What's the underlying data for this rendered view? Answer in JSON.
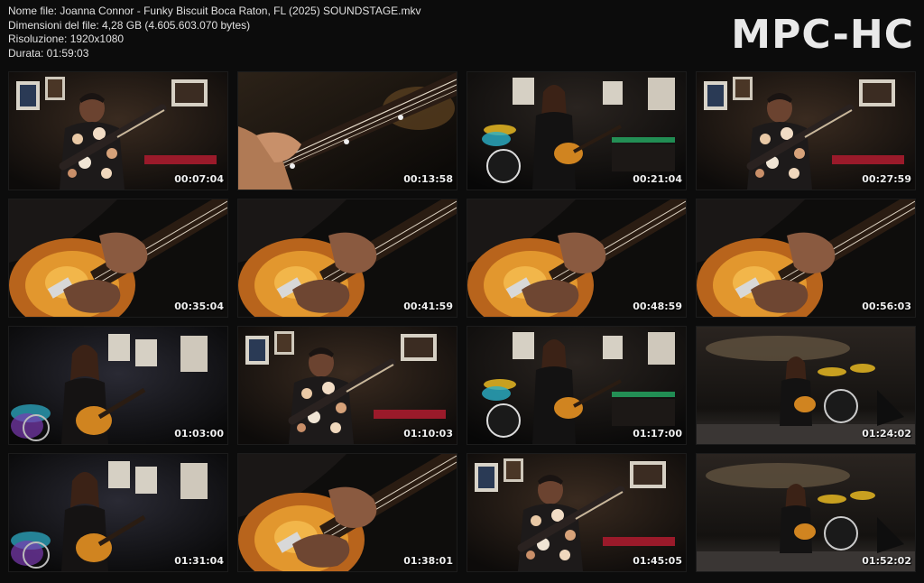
{
  "header": {
    "file_name": "Nome file: Joanna Connor - Funky Biscuit Boca Raton, FL (2025) SOUNDSTAGE.mkv",
    "file_size": "Dimensioni del file: 4,28 GB (4.605.603.070 bytes)",
    "resolution": "Risoluzione: 1920x1080",
    "duration": "Durata: 01:59:03",
    "logo": "MPC-HC"
  },
  "thumbnails": [
    {
      "time": "00:07:04",
      "scene": "bassist"
    },
    {
      "time": "00:13:58",
      "scene": "neck"
    },
    {
      "time": "00:21:04",
      "scene": "band"
    },
    {
      "time": "00:27:59",
      "scene": "bassist"
    },
    {
      "time": "00:35:04",
      "scene": "guitar"
    },
    {
      "time": "00:41:59",
      "scene": "guitar"
    },
    {
      "time": "00:48:59",
      "scene": "guitar"
    },
    {
      "time": "00:56:03",
      "scene": "guitar"
    },
    {
      "time": "01:03:00",
      "scene": "singer"
    },
    {
      "time": "01:10:03",
      "scene": "bassist"
    },
    {
      "time": "01:17:00",
      "scene": "band"
    },
    {
      "time": "01:24:02",
      "scene": "stage"
    },
    {
      "time": "01:31:04",
      "scene": "singer"
    },
    {
      "time": "01:38:01",
      "scene": "guitar"
    },
    {
      "time": "01:45:05",
      "scene": "bassist"
    },
    {
      "time": "01:52:02",
      "scene": "stage"
    }
  ]
}
